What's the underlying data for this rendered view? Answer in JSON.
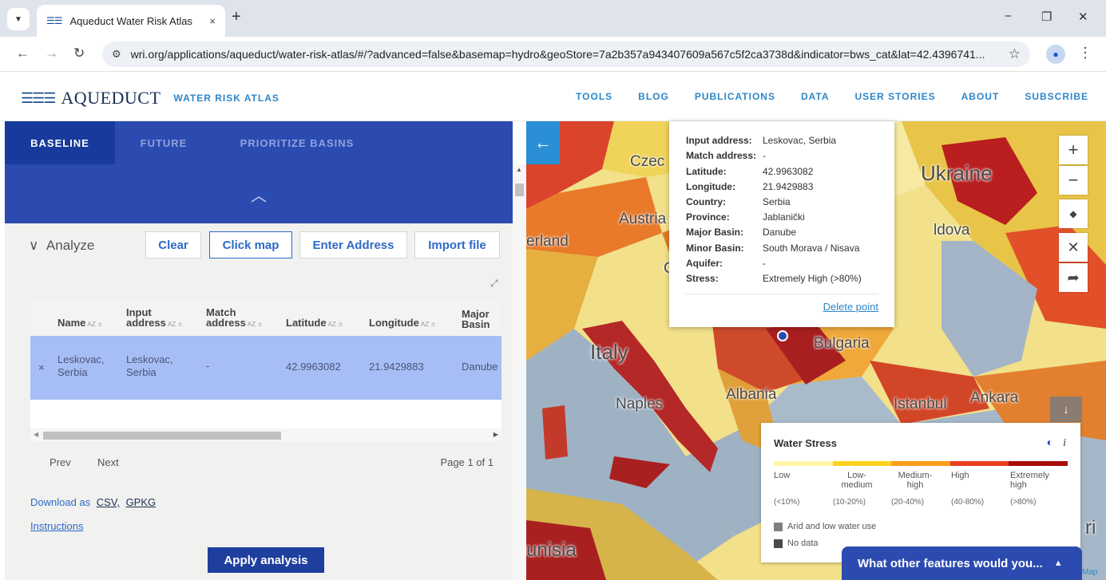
{
  "browser": {
    "tab_title": "Aqueduct Water Risk Atlas",
    "tab_close": "×",
    "new_tab": "+",
    "url": "wri.org/applications/aqueduct/water-risk-atlas/#/?advanced=false&basemap=hydro&geoStore=7a2b357a943407609a567c5f2ca3738d&indicator=bws_cat&lat=42.4396741...",
    "win_minimize": "−",
    "win_restore": "❐",
    "win_close": "✕"
  },
  "header": {
    "logo_word": "AQUEDUCT",
    "logo_sub": "WATER RISK ATLAS",
    "nav": [
      "TOOLS",
      "BLOG",
      "PUBLICATIONS",
      "DATA",
      "USER STORIES",
      "ABOUT",
      "SUBSCRIBE"
    ]
  },
  "panel": {
    "tabs": [
      "BASELINE",
      "FUTURE",
      "PRIORITIZE BASINS"
    ],
    "analyze_title": "Analyze",
    "buttons": {
      "clear": "Clear",
      "click_map": "Click map",
      "enter_address": "Enter Address",
      "import_file": "Import file"
    },
    "table": {
      "headers": [
        {
          "l1": "",
          "l2": "Name"
        },
        {
          "l1": "Input",
          "l2": "address"
        },
        {
          "l1": "Match",
          "l2": "address"
        },
        {
          "l1": "",
          "l2": "Latitude"
        },
        {
          "l1": "",
          "l2": "Longitude"
        },
        {
          "l1": "Major",
          "l2": "Basin"
        }
      ],
      "row": {
        "remove": "×",
        "name_1": "Leskovac,",
        "name_2": "Serbia",
        "input_1": "Leskovac,",
        "input_2": "Serbia",
        "match": "-",
        "latitude": "42.9963082",
        "longitude": "21.9429883",
        "major_basin": "Danube"
      }
    },
    "pager": {
      "prev": "Prev",
      "next": "Next",
      "page_info": "Page 1 of 1"
    },
    "download_label": "Download as",
    "download_csv": "CSV,",
    "download_gpkg": "GPKG",
    "instructions": "Instructions",
    "apply": "Apply analysis"
  },
  "map": {
    "labels": [
      "Czec",
      "Austria",
      "erland",
      "Ukraine",
      "ldova",
      "Italy",
      "Bulgaria",
      "Naples",
      "Albania",
      "Istanbul",
      "Ankara",
      "unisia",
      "C",
      "ri"
    ],
    "popup": {
      "rows": [
        {
          "k": "Input address:",
          "v": "Leskovac, Serbia"
        },
        {
          "k": "Match address:",
          "v": "-"
        },
        {
          "k": "Latitude:",
          "v": "42.9963082"
        },
        {
          "k": "Longitude:",
          "v": "21.9429883"
        },
        {
          "k": "Country:",
          "v": "Serbia"
        },
        {
          "k": "Province:",
          "v": "Jablanički"
        },
        {
          "k": "Major Basin:",
          "v": "Danube"
        },
        {
          "k": "Minor Basin:",
          "v": "South Morava / Nisava"
        },
        {
          "k": "Aquifer:",
          "v": "-"
        },
        {
          "k": "Stress:",
          "v": "Extremely High (>80%)"
        }
      ],
      "delete": "Delete point"
    },
    "legend": {
      "title": "Water Stress",
      "info": "i",
      "colors": [
        "#fff4a8",
        "#ffd21f",
        "#ff9e1b",
        "#e8401f",
        "#a80a0a"
      ],
      "categories": [
        {
          "label": "Low",
          "range": "(<10%)"
        },
        {
          "label": "Low-medium",
          "range": "(10-20%)"
        },
        {
          "label": "Medium-high",
          "range": "(20-40%)"
        },
        {
          "label": "High",
          "range": "(40-80%)"
        },
        {
          "label": "Extremely high",
          "range": "(>80%)"
        }
      ],
      "arid": "Arid and low water use",
      "nodata": "No data",
      "arid_color": "#808080",
      "nodata_color": "#4a4a4a"
    },
    "feedback": "What other features would you...",
    "attribution": "Map"
  }
}
